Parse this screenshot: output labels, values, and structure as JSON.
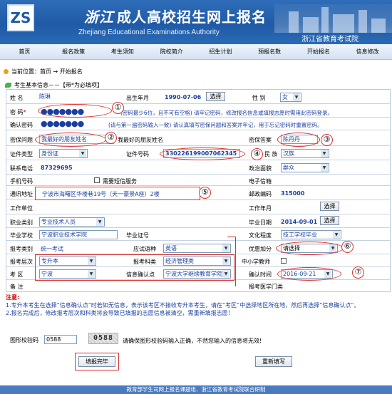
{
  "header": {
    "logo": "ZS",
    "title_script": "浙江",
    "title": "成人高校招生网上报名",
    "subtitle_en": "Zhejiang Educational Examinations Authority",
    "org": "浙江省教育考试院"
  },
  "nav": [
    "首页",
    "报名政策",
    "考生须知",
    "院校简介",
    "招生计划",
    "预报名数",
    "开始报名",
    "信息修改"
  ],
  "location": "当前位置：首页 → 开始报名",
  "section": "考生基本信息－－【带*为必填项】",
  "form": {
    "name_label": "姓 名",
    "name": "陈琳",
    "dob_label": "出生年月",
    "dob": "1990-07-06",
    "select_btn": "选择",
    "sex_label": "性 别",
    "sex": "女",
    "pwd_label": "密 码",
    "pwd_dots": "●●●●●●●",
    "pwd_note": "(密码最少6位，且不可有空格) 请牢记密码，修改报名信息或填报志愿时需用此密码登录。",
    "confirm_label": "确认密码",
    "confirm_note": "(请与第一遍密码输入一致) 请认真填写密保问题和答案并牢记，用于忘记密码时重置密码。",
    "q_label": "密保问题",
    "q_value": "我最好的朋友姓名",
    "q_text": "我最好的朋友姓名",
    "a_label": "密保答案",
    "a_value": "陈丹丹",
    "idtype_label": "证件类型",
    "idtype": "身份证",
    "idno_label": "证件号码",
    "idno": "330226199007062345",
    "nation_label": "民 族",
    "nation": "汉族",
    "phone_label": "联系电话",
    "phone": "87329695",
    "political_label": "政治面貌",
    "political": "群众",
    "mobile_label": "手机号码",
    "sms": "需要短信服务",
    "email_label": "电子信箱",
    "address_label": "通讯地址",
    "address": "宁波市海曙区华楼巷19号（天一豪景A座）2楼",
    "zip_label": "邮政编码",
    "zip": "315000",
    "work_label": "工作单位",
    "workdate_label": "工作年月",
    "job_label": "职业类别",
    "job": "专业技术人员",
    "grad_label": "毕业日期",
    "grad": "2014-09-01",
    "school_label": "毕业学校",
    "school": "宁波职业技术学院",
    "cert_label": "毕业证号",
    "edu_label": "文化程度",
    "edu": "技工学校毕业",
    "cat_label": "报考类别",
    "cat": "统一考试",
    "lang_label": "应试语种",
    "lang": "英语",
    "bonus_label": "优惠加分",
    "bonus": "请选择",
    "level_label": "报考层次",
    "level": "专升本",
    "subject_label": "报考科类",
    "subject": "经济管理类",
    "teacher_label": "中小学教师",
    "area_label": "考 区",
    "area": "宁波",
    "point_label": "信息确认点",
    "point": "宁波大学继续教育学院",
    "time_label": "确认时间",
    "time": "2016-09-21",
    "remark_label": "备 注",
    "medical_label": "报考医学门类"
  },
  "numbers": [
    "①",
    "②",
    "③",
    "④",
    "⑤",
    "⑥",
    "⑦"
  ],
  "notes": {
    "title": "注意:",
    "n1": "1.专升本考生在选择“信息确认点”时若如无信息，表示该考区不接收专升本考生，请在“考区”中选择地区所在地，然后再选择“信息确认点”。",
    "n2": "2.报名完成后，修改报考层次和科类将会导致已填报的志愿信息被清空，需重新填报志愿！"
  },
  "captcha": {
    "label": "图形校验码",
    "value": "0588",
    "image_text": "0588",
    "hint": "请确保图形校验码输入正确，不然您输入的信息将无效!"
  },
  "buttons": {
    "submit": "填报完毕",
    "reset": "重新填写"
  },
  "footer": "教育部学生司网上报名课题组、浙江省教育考试院联合研制"
}
